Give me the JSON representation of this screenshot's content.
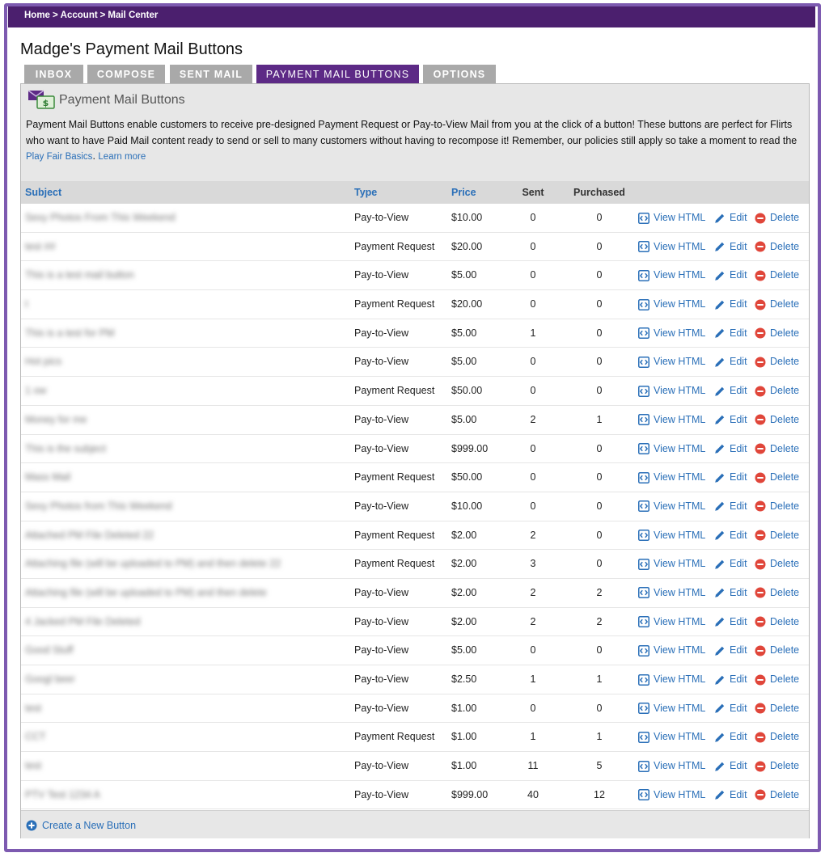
{
  "breadcrumb": {
    "items": [
      "Home",
      "Account",
      "Mail Center"
    ],
    "separator": ">"
  },
  "page_title": "Madge's Payment Mail Buttons",
  "tabs": [
    {
      "label": "INBOX",
      "active": false
    },
    {
      "label": "COMPOSE",
      "active": false
    },
    {
      "label": "SENT MAIL",
      "active": false
    },
    {
      "label": "PAYMENT MAIL BUTTONS",
      "active": true
    },
    {
      "label": "OPTIONS",
      "active": false
    }
  ],
  "intro": {
    "icon": "mail-money-icon",
    "heading": "Payment Mail Buttons",
    "description": "Payment Mail Buttons enable customers to receive pre-designed Payment Request or Pay-to-View Mail from you at the click of a button! These buttons are perfect for Flirts who want to have Paid Mail content ready to send or sell to many customers without having to recompose it! Remember, our policies still apply so take a moment to read the",
    "link_label": "Play Fair Basics",
    "link_suffix": ".",
    "learn_more": "Learn more"
  },
  "table": {
    "columns": {
      "subject": "Subject",
      "type": "Type",
      "price": "Price",
      "sent": "Sent",
      "purchased": "Purchased"
    },
    "actions": {
      "view": "View HTML",
      "edit": "Edit",
      "delete": "Delete"
    },
    "rows": [
      {
        "subject": "Sexy Photos From This Weekend",
        "type": "Pay-to-View",
        "price": "$10.00",
        "sent": "0",
        "purchased": "0"
      },
      {
        "subject": "test ##",
        "type": "Payment Request",
        "price": "$20.00",
        "sent": "0",
        "purchased": "0"
      },
      {
        "subject": "This is a test mail button",
        "type": "Pay-to-View",
        "price": "$5.00",
        "sent": "0",
        "purchased": "0"
      },
      {
        "subject": "t",
        "type": "Payment Request",
        "price": "$20.00",
        "sent": "0",
        "purchased": "0"
      },
      {
        "subject": "This is a test for PM",
        "type": "Pay-to-View",
        "price": "$5.00",
        "sent": "1",
        "purchased": "0"
      },
      {
        "subject": "Hot pics",
        "type": "Pay-to-View",
        "price": "$5.00",
        "sent": "0",
        "purchased": "0"
      },
      {
        "subject": "1 ow",
        "type": "Payment Request",
        "price": "$50.00",
        "sent": "0",
        "purchased": "0"
      },
      {
        "subject": "Money for me",
        "type": "Pay-to-View",
        "price": "$5.00",
        "sent": "2",
        "purchased": "1"
      },
      {
        "subject": "This is the subject",
        "type": "Pay-to-View",
        "price": "$999.00",
        "sent": "0",
        "purchased": "0"
      },
      {
        "subject": "Mass Mail",
        "type": "Payment Request",
        "price": "$50.00",
        "sent": "0",
        "purchased": "0"
      },
      {
        "subject": "Sexy Photos from This Weekend",
        "type": "Pay-to-View",
        "price": "$10.00",
        "sent": "0",
        "purchased": "0"
      },
      {
        "subject": "Attached PM File Deleted 22",
        "type": "Payment Request",
        "price": "$2.00",
        "sent": "2",
        "purchased": "0"
      },
      {
        "subject": "Attaching file (will be uploaded to PM) and then delete 22",
        "type": "Payment Request",
        "price": "$2.00",
        "sent": "3",
        "purchased": "0"
      },
      {
        "subject": "Attaching file (will be uploaded to PM) and then delete",
        "type": "Pay-to-View",
        "price": "$2.00",
        "sent": "2",
        "purchased": "2"
      },
      {
        "subject": "4 Jacked PM File Deleted",
        "type": "Pay-to-View",
        "price": "$2.00",
        "sent": "2",
        "purchased": "2"
      },
      {
        "subject": "Good Stuff",
        "type": "Pay-to-View",
        "price": "$5.00",
        "sent": "0",
        "purchased": "0"
      },
      {
        "subject": "Googl beer",
        "type": "Pay-to-View",
        "price": "$2.50",
        "sent": "1",
        "purchased": "1"
      },
      {
        "subject": "test",
        "type": "Pay-to-View",
        "price": "$1.00",
        "sent": "0",
        "purchased": "0"
      },
      {
        "subject": "CCT",
        "type": "Payment Request",
        "price": "$1.00",
        "sent": "1",
        "purchased": "1"
      },
      {
        "subject": "test",
        "type": "Pay-to-View",
        "price": "$1.00",
        "sent": "11",
        "purchased": "5"
      },
      {
        "subject": "PTV Test 1234 A",
        "type": "Pay-to-View",
        "price": "$999.00",
        "sent": "40",
        "purchased": "12"
      }
    ]
  },
  "footer": {
    "create_label": "Create a New Button"
  },
  "colors": {
    "brand_purple": "#4b1f6e",
    "active_tab": "#5d2a86",
    "link_blue": "#2a6fb8",
    "delete_red": "#e0463a",
    "frame": "#7d5ab0"
  }
}
